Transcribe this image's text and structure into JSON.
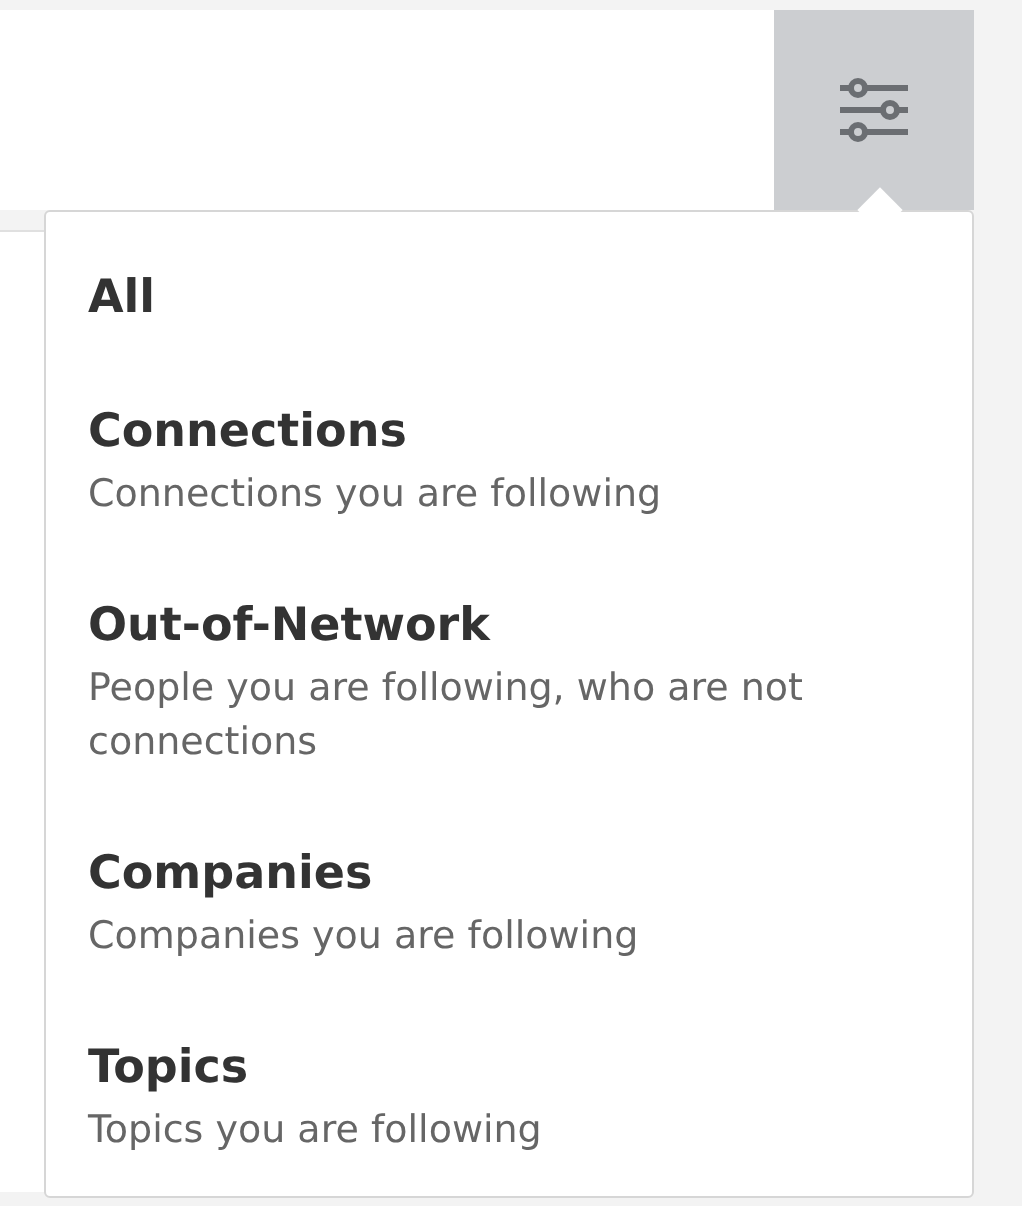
{
  "filter_menu": {
    "items": [
      {
        "title": "All"
      },
      {
        "title": "Connections",
        "description": "Connections you are following"
      },
      {
        "title": "Out-of-Network",
        "description": "People you are following, who are not connections"
      },
      {
        "title": "Companies",
        "description": "Companies you are following"
      },
      {
        "title": "Topics",
        "description": "Topics you are following"
      }
    ]
  }
}
